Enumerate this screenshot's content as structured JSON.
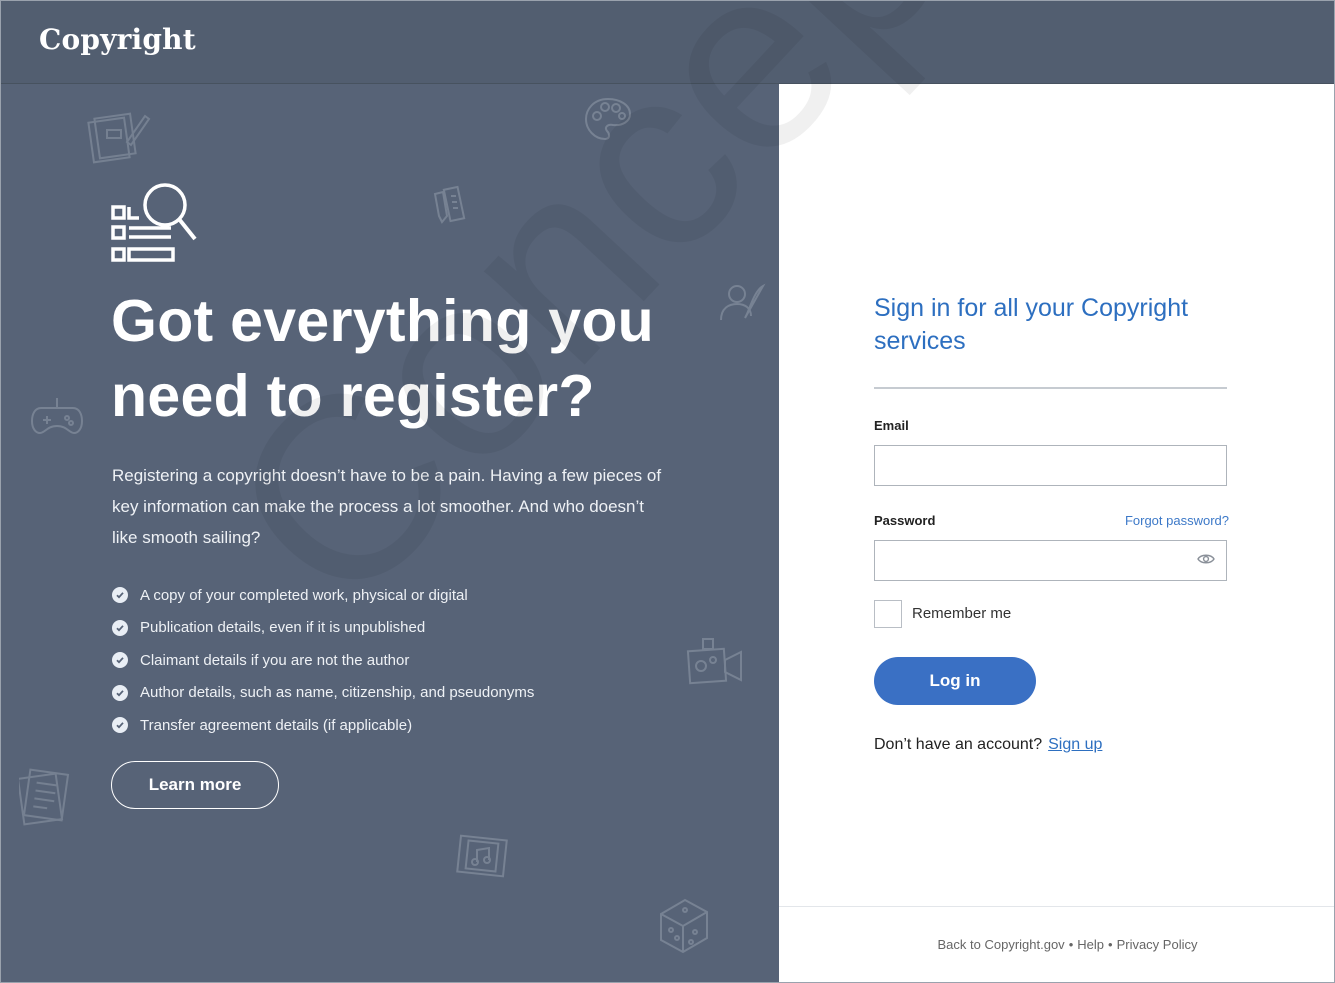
{
  "brand": {
    "logo_text": "Copyright"
  },
  "hero": {
    "headline_line1": "Got everything you",
    "headline_line2": "need to register?",
    "intro": "Registering a copyright doesn’t have to be a pain. Having a few pieces of key information can make the process a lot smoother. And who doesn’t like smooth sailing?",
    "checklist": [
      "A copy of your completed work, physical or digital",
      "Publication details, even if it is unpublished",
      "Claimant details if you are not the author",
      "Author details, such as name, citizenship, and pseudonyms",
      "Transfer agreement details (if applicable)"
    ],
    "learn_more": "Learn more"
  },
  "watermark": "Concept",
  "signin": {
    "title": "Sign in for all your Copyright services",
    "email_label": "Email",
    "email_value": "",
    "password_label": "Password",
    "password_value": "",
    "forgot": "Forgot password?",
    "remember": "Remember me",
    "login": "Log in",
    "no_account": "Don’t have an account?",
    "signup": "Sign up"
  },
  "footer": {
    "links": [
      "Back to Copyright.gov",
      "Help",
      "Privacy Policy"
    ],
    "separator": "•"
  },
  "colors": {
    "topbar": "#525e70",
    "left_panel": "#576377",
    "accent": "#3a70c4",
    "link": "#2d6fc0"
  },
  "icons": [
    "document-pen-icon",
    "palette-icon",
    "pencil-ruler-icon",
    "portrait-quill-icon",
    "game-controller-icon",
    "video-camera-icon",
    "sheet-stack-icon",
    "music-film-icon",
    "dice-icon",
    "registry-search-icon",
    "check-circle-icon",
    "eye-icon"
  ]
}
